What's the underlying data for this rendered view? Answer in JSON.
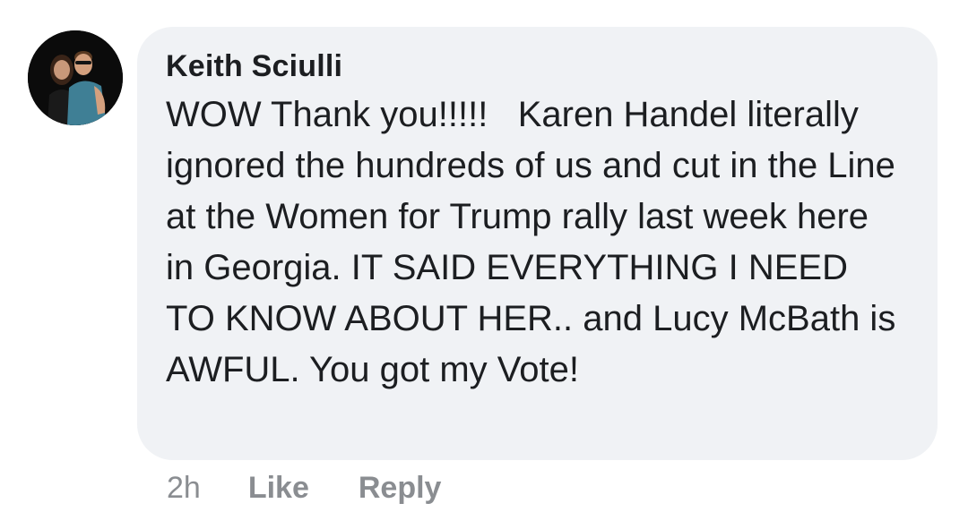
{
  "comment": {
    "author": "Keith Sciulli",
    "text": "WOW Thank you!!!!!   Karen Handel literally ignored the hundreds of us and cut in the Line at the Women for Trump rally last week here in Georgia. IT SAID EVERYTHING I NEED TO KNOW ABOUT HER.. and Lucy McBath is AWFUL. You got my Vote!",
    "timestamp": "2h",
    "like_label": "Like",
    "reply_label": "Reply"
  },
  "colors": {
    "bubble": "#f0f2f5",
    "text": "#1c1e21",
    "meta": "#8a8d91"
  }
}
